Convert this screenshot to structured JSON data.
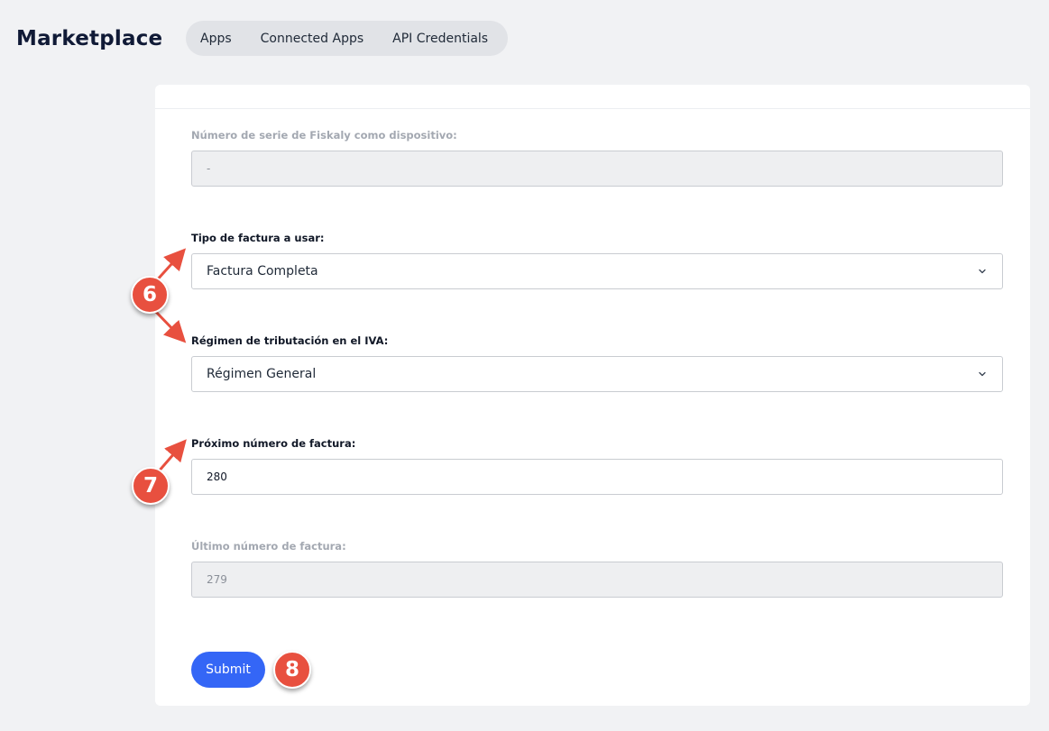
{
  "header": {
    "title": "Marketplace",
    "tabs": [
      {
        "label": "Apps"
      },
      {
        "label": "Connected Apps"
      },
      {
        "label": "API Credentials"
      }
    ]
  },
  "form": {
    "serial": {
      "label": "Número de serie de Fiskaly como dispositivo:",
      "value": "-"
    },
    "invoice_type": {
      "label": "Tipo de factura a usar:",
      "value": "Factura Completa"
    },
    "tax_regime": {
      "label": "Régimen de tributación en el IVA:",
      "value": "Régimen General"
    },
    "next_invoice": {
      "label": "Próximo número de factura:",
      "value": "280"
    },
    "last_invoice": {
      "label": "Último número de factura:",
      "value": "279"
    },
    "submit_label": "Submit"
  },
  "annotations": {
    "step6": "6",
    "step7": "7",
    "step8": "8"
  },
  "colors": {
    "accent": "#3466f6",
    "annotation": "#e8503f",
    "background": "#f1f2f4"
  }
}
